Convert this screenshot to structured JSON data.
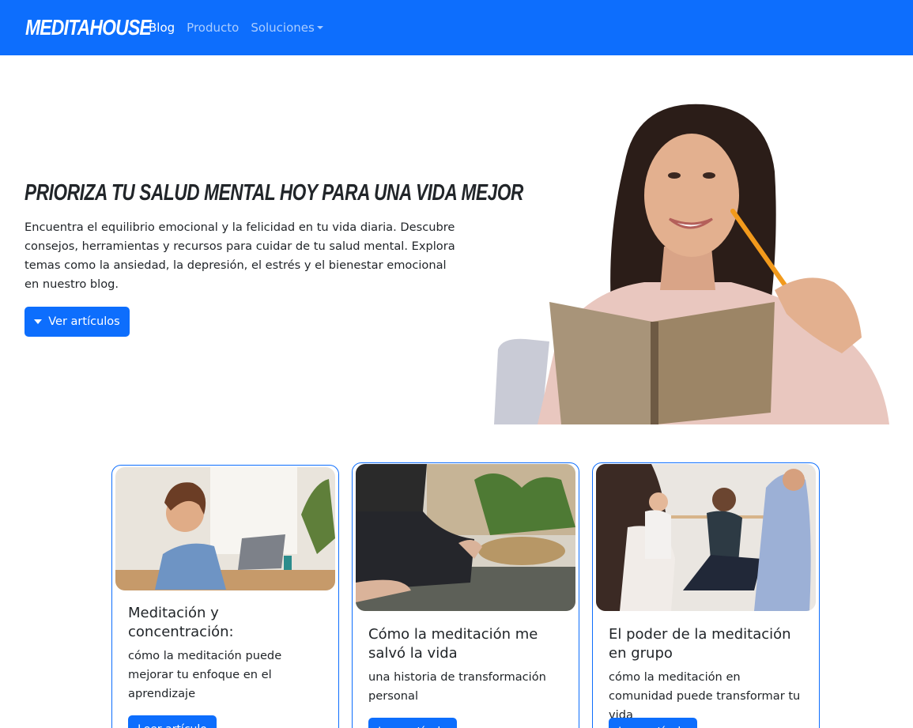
{
  "navbar": {
    "brand": "MEDITAHOUSE",
    "links": [
      {
        "label": "Blog"
      },
      {
        "label": "Producto"
      },
      {
        "label": "Soluciones"
      }
    ],
    "color": "#0d6efd"
  },
  "hero": {
    "title": "PRIORIZA TU SALUD MENTAL HOY PARA UNA VIDA MEJOR",
    "text": "Encuentra el equilibrio emocional y la felicidad en tu vida diaria. Descubre consejos, herramientas y recursos para cuidar de tu salud mental. Explora temas como la ansiedad, la depresión, el estrés y el bienestar emocional en nuestro blog.",
    "button_label": "Ver artículos",
    "button_icon": "caret-down-icon"
  },
  "cards": [
    {
      "title": "Meditación y concentración:",
      "text": "cómo la meditación puede mejorar tu enfoque en el aprendizaje",
      "button_label": "Leer artículo"
    },
    {
      "title": "Cómo la meditación me salvó la vida",
      "text": "una historia de transformación personal",
      "button_label": "Leer artículo"
    },
    {
      "title": "El poder de la meditación en grupo",
      "text": "cómo la meditación en comunidad puede transformar tu vida",
      "button_label": "Leer artículo"
    }
  ]
}
